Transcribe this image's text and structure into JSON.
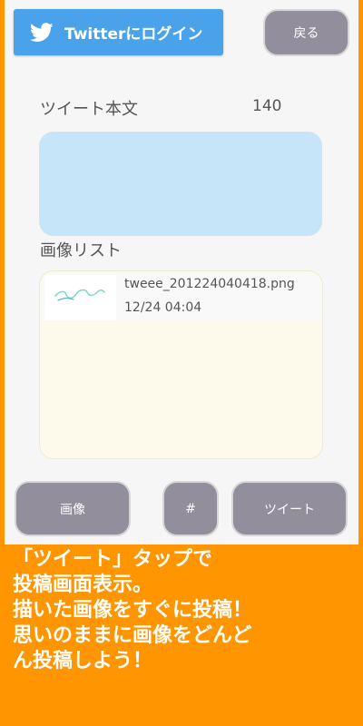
{
  "header": {
    "twitter_login_label": "Twitterにログイン",
    "back_label": "戻る"
  },
  "compose": {
    "label": "ツイート本文",
    "remaining_chars": "140",
    "text": ""
  },
  "images": {
    "label": "画像リスト",
    "items": [
      {
        "file_name": "tweee_201224040418.png",
        "date": "12/24 04:04"
      }
    ]
  },
  "actions": {
    "image_label": "画像",
    "hashtag_label": "#",
    "tweet_label": "ツイート"
  },
  "caption": {
    "lines": [
      "「ツイート」タップで",
      "投稿画面表示。",
      "描いた画像をすぐに投稿！",
      "思いのままに画像をどんど",
      "ん投稿しよう！"
    ]
  },
  "colors": {
    "background": "#ff9500",
    "twitter_blue": "#4aa3ea",
    "button_gray": "#928e9b",
    "tweet_box": "#c6e5f8",
    "list_bg": "#fdfaeb"
  }
}
